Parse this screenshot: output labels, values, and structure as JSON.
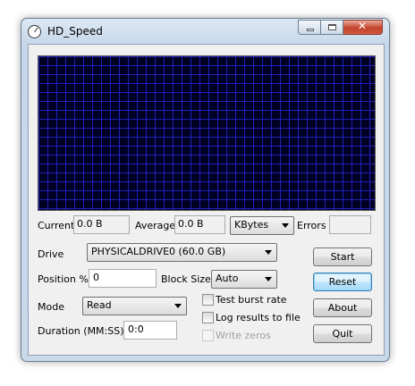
{
  "window": {
    "title": "HD_Speed"
  },
  "close_glyph": "✕",
  "stats": {
    "current_label": "Current",
    "current_value": "0.0 B",
    "average_label": "Average",
    "average_value": "0.0 B",
    "unit_selected": "KBytes",
    "errors_label": "Errors",
    "errors_value": ""
  },
  "drive": {
    "label": "Drive",
    "selected": "PHYSICALDRIVE0 (60.0 GB)"
  },
  "position": {
    "label": "Position %",
    "value": "0"
  },
  "block_size": {
    "label": "Block Size",
    "selected": "Auto"
  },
  "mode": {
    "label": "Mode",
    "selected": "Read"
  },
  "duration": {
    "label": "Duration (MM:SS)",
    "value": "0:0"
  },
  "options": {
    "test_burst_rate": "Test burst rate",
    "log_results": "Log results to file",
    "write_zeros": "Write zeros"
  },
  "buttons": {
    "start": "Start",
    "reset": "Reset",
    "about": "About",
    "quit": "Quit"
  },
  "colors": {
    "graph_background": "#000022",
    "graph_grid": "#2020b8"
  },
  "icons": {
    "app": "stopwatch-icon",
    "minimize": "minimize-icon",
    "maximize": "maximize-icon",
    "close": "close-icon"
  }
}
